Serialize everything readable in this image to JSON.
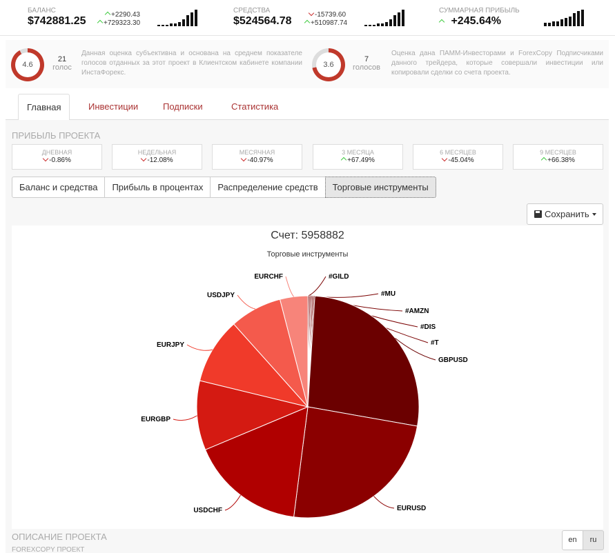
{
  "stats": [
    {
      "label": "БАЛАНС",
      "value": "$742881.25",
      "change1": "+2290.43",
      "change1_dir": "up",
      "change2": "+729323.30",
      "change2_dir": "up",
      "spark": [
        1,
        1,
        1,
        2,
        2,
        3,
        5,
        8,
        10,
        12
      ]
    },
    {
      "label": "СРЕДСТВА",
      "value": "$524564.78",
      "change1": "-15739.60",
      "change1_dir": "down",
      "change2": "+510987.74",
      "change2_dir": "up",
      "spark": [
        1,
        1,
        1,
        2,
        2,
        3,
        5,
        8,
        10,
        12
      ]
    },
    {
      "label": "СУММАРНАЯ ПРИБЫЛЬ",
      "value": "+245.64%",
      "value_dir": "up",
      "spark": [
        2,
        2,
        3,
        3,
        4,
        5,
        6,
        8,
        9,
        10
      ]
    }
  ],
  "ratings": [
    {
      "score": "4.6",
      "score_fraction": 0.92,
      "votes_count": "21",
      "votes_label": "голос",
      "description": "Данная оценка субъективна и основана на среднем показателе голосов отданных за этот проект в Клиентском кабинете компании ИнстаФорекс."
    },
    {
      "score": "3.6",
      "score_fraction": 0.72,
      "votes_count": "7",
      "votes_label": "голосов",
      "description": "Оценка дана ПАММ-Инвесторами и ForexCopy Подписчиками данного трейдера, которые совершали инвестиции или копировали сделки со счета проекта."
    }
  ],
  "tabs": [
    "Главная",
    "Инвестиции",
    "Подписки",
    "Статистика"
  ],
  "active_tab": "Главная",
  "profit_section_title": "ПРИБЫЛЬ ПРОЕКТА",
  "profits": [
    {
      "label": "ДНЕВНАЯ",
      "value": "-0.86%",
      "dir": "down"
    },
    {
      "label": "НЕДЕЛЬНАЯ",
      "value": "-12.08%",
      "dir": "down"
    },
    {
      "label": "МЕСЯЧНАЯ",
      "value": "-40.97%",
      "dir": "down"
    },
    {
      "label": "3 МЕСЯЦА",
      "value": "+67.49%",
      "dir": "up"
    },
    {
      "label": "6 МЕСЯЦЕВ",
      "value": "-45.04%",
      "dir": "down"
    },
    {
      "label": "9 МЕСЯЦЕВ",
      "value": "+66.38%",
      "dir": "up"
    }
  ],
  "chart_tabs": [
    "Баланс и средства",
    "Прибыль в процентах",
    "Распределение средств",
    "Торговые инструменты"
  ],
  "active_chart_tab": "Торговые инструменты",
  "save_label": "Сохранить",
  "colors": {
    "accent": "#aa3333",
    "up": "#44bb44",
    "down": "#cc3333"
  },
  "chart_data": {
    "type": "pie",
    "title": "Счет: 5958882",
    "subtitle": "Торговые инструменты",
    "slices": [
      {
        "name": "#GILD",
        "value": 0.2,
        "color": "#7a0000"
      },
      {
        "name": "#MU",
        "value": 0.2,
        "color": "#7a0000"
      },
      {
        "name": "#AMZN",
        "value": 0.2,
        "color": "#7a0000"
      },
      {
        "name": "#DIS",
        "value": 0.2,
        "color": "#7a0000"
      },
      {
        "name": "#T",
        "value": 0.2,
        "color": "#7a0000"
      },
      {
        "name": "GBPUSD",
        "value": 26.5,
        "color": "#6b0000"
      },
      {
        "name": "EURUSD",
        "value": 24.0,
        "color": "#8b0000"
      },
      {
        "name": "USDCHF",
        "value": 16.5,
        "color": "#b00000"
      },
      {
        "name": "EURGBP",
        "value": 10.0,
        "color": "#d41a12"
      },
      {
        "name": "EURJPY",
        "value": 9.5,
        "color": "#f03a2a"
      },
      {
        "name": "USDJPY",
        "value": 7.5,
        "color": "#f45a4c"
      },
      {
        "name": "EURCHF",
        "value": 4.0,
        "color": "#f7847a"
      }
    ]
  },
  "description_title": "ОПИСАНИЕ ПРОЕКТА",
  "forexcopy_title": "FOREXCOPY ПРОЕКТ",
  "languages": [
    "en",
    "ru"
  ],
  "active_language": "ru"
}
